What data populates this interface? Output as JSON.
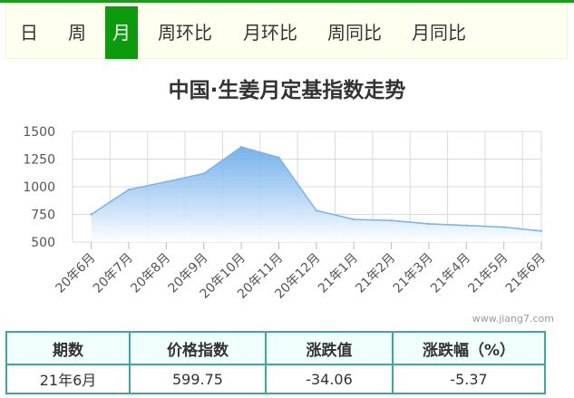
{
  "tabs": [
    {
      "label": "日",
      "active": false
    },
    {
      "label": "周",
      "active": false
    },
    {
      "label": "月",
      "active": true
    },
    {
      "label": "周环比",
      "active": false
    },
    {
      "label": "月环比",
      "active": false
    },
    {
      "label": "周同比",
      "active": false
    },
    {
      "label": "月同比",
      "active": false
    }
  ],
  "watermark": "www.jiang7.com",
  "chart_data": {
    "type": "area",
    "title": "中国·生姜月定基指数走势",
    "xlabel": "",
    "ylabel": "",
    "categories": [
      "20年6月",
      "20年7月",
      "20年8月",
      "20年9月",
      "20年10月",
      "20年11月",
      "20年12月",
      "21年1月",
      "21年2月",
      "21年3月",
      "21年4月",
      "21年5月",
      "21年6月"
    ],
    "values": [
      750,
      975,
      1045,
      1120,
      1360,
      1265,
      785,
      705,
      695,
      665,
      650,
      635,
      600
    ],
    "yticks": [
      500,
      750,
      1000,
      1250,
      1500
    ],
    "ylim": [
      500,
      1500
    ],
    "grid": true,
    "line_color": "#7cb5ec",
    "fill_color_top": "#5fa5e8",
    "fill_color_bottom": "#ffffff"
  },
  "table": {
    "headers": [
      "期数",
      "价格指数",
      "涨跌值",
      "涨跌幅（%）"
    ],
    "rows": [
      [
        "21年6月",
        "599.75",
        "-34.06",
        "-5.37"
      ]
    ]
  }
}
